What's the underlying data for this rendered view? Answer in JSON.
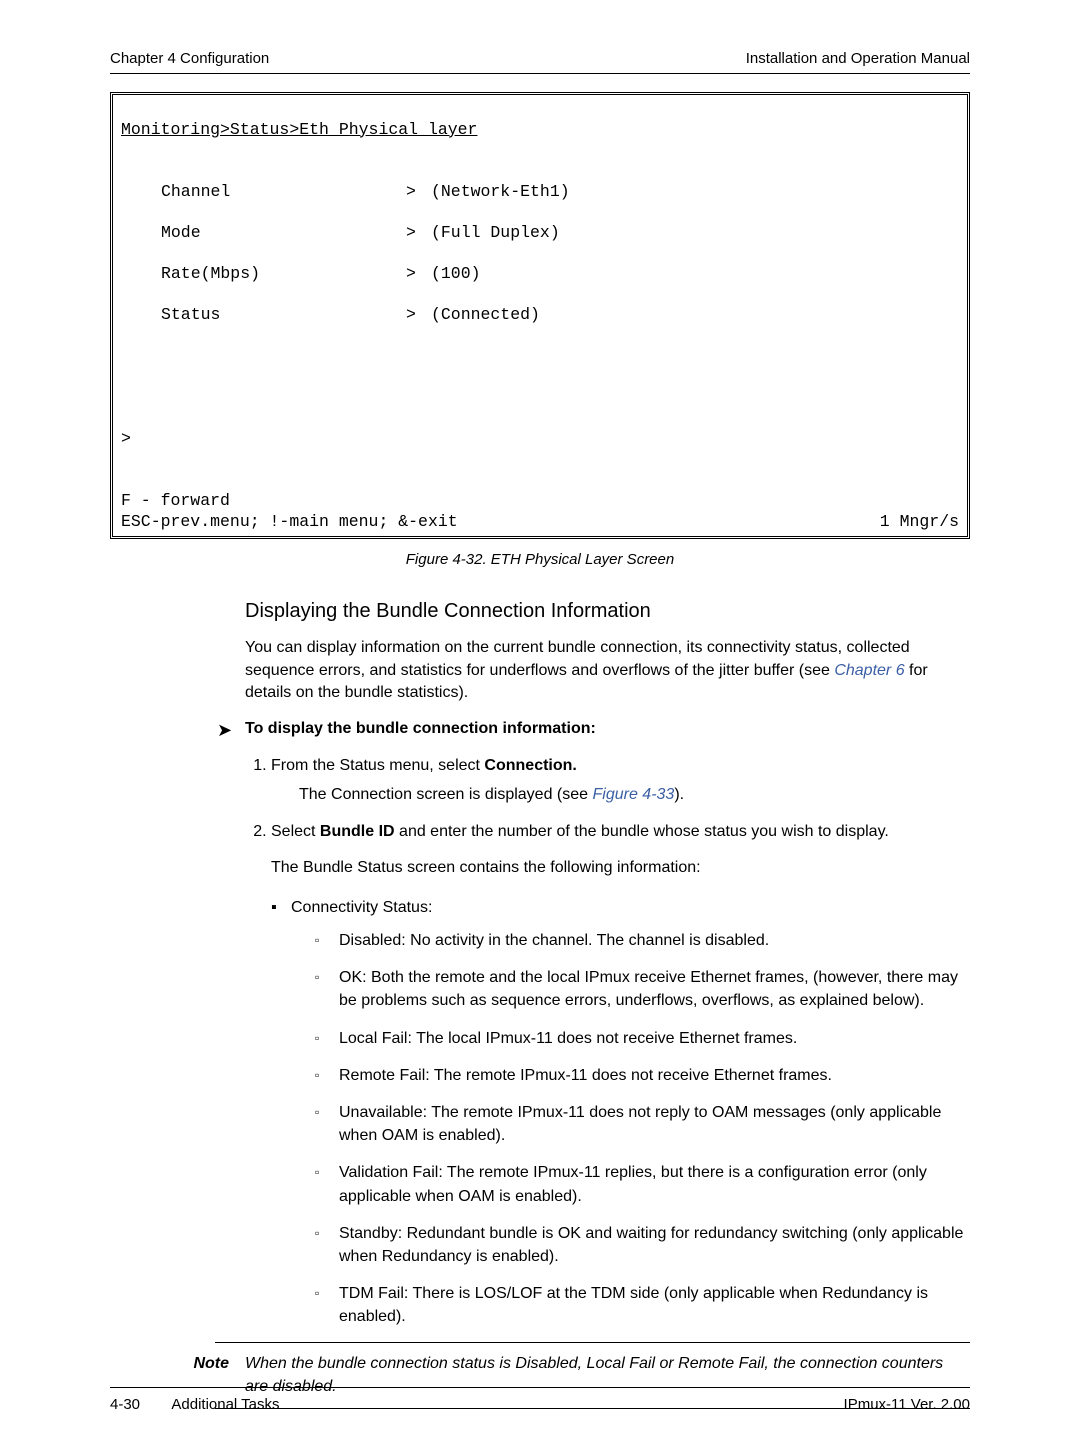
{
  "running_head": {
    "left": "Chapter 4  Configuration",
    "right": "Installation and Operation Manual"
  },
  "terminal": {
    "title": "Monitoring>Status>Eth Physical layer",
    "rows": [
      {
        "label": "Channel",
        "arrow": ">",
        "value": "(Network-Eth1)"
      },
      {
        "label": "Mode",
        "arrow": ">",
        "value": "(Full Duplex)"
      },
      {
        "label": "Rate(Mbps)",
        "arrow": ">",
        "value": "(100)"
      },
      {
        "label": "Status",
        "arrow": ">",
        "value": "(Connected)"
      }
    ],
    "prompt_marker": ">",
    "forward_hint": "F - forward",
    "bottom_left": "ESC-prev.menu; !-main menu; &-exit",
    "bottom_right": "1 Mngr/s"
  },
  "figure_caption": "Figure 4-32.  ETH Physical Layer Screen",
  "section_heading": "Displaying the Bundle Connection Information",
  "intro": {
    "pre": "You can display information on the current bundle connection, its connectivity status, collected sequence errors, and statistics for underflows and overflows of the jitter buffer (see ",
    "link": "Chapter 6",
    "post": " for details on the bundle statistics)."
  },
  "procedure_title": "To display the bundle connection information:",
  "steps": {
    "s1_pre": "From the Status menu, select ",
    "s1_bold": "Connection.",
    "s1_sub_pre": "The Connection screen is displayed (see ",
    "s1_sub_link": "Figure 4-33",
    "s1_sub_post": ").",
    "s2_pre": "Select ",
    "s2_bold": "Bundle ID",
    "s2_post": " and enter the number of the bundle whose status you wish to display.",
    "info_line": "The Bundle Status screen contains the following information:"
  },
  "bullets": {
    "top": "Connectivity Status:",
    "items": [
      "Disabled: No activity in the channel. The channel is disabled.",
      "OK: Both the remote and the local IPmux receive Ethernet frames, (however, there may be problems such as sequence errors, underflows, overflows, as explained below).",
      "Local Fail: The local IPmux-11 does not receive Ethernet frames.",
      "Remote Fail: The remote IPmux-11 does not receive Ethernet frames.",
      "Unavailable: The remote IPmux-11 does not reply to OAM messages (only applicable when OAM is enabled).",
      "Validation Fail: The remote IPmux-11 replies, but there is a configuration error (only applicable when OAM is enabled).",
      "Standby: Redundant bundle is OK and waiting for redundancy switching (only applicable when Redundancy is enabled).",
      "TDM Fail: There is LOS/LOF at the TDM side (only applicable when Redundancy is enabled)."
    ]
  },
  "note": {
    "label": "Note",
    "body": "When the bundle connection status is Disabled, Local Fail or Remote Fail, the connection counters are disabled."
  },
  "footer": {
    "page_no": "4-30",
    "section": "Additional Tasks",
    "product": "IPmux-11 Ver. 2.00"
  }
}
